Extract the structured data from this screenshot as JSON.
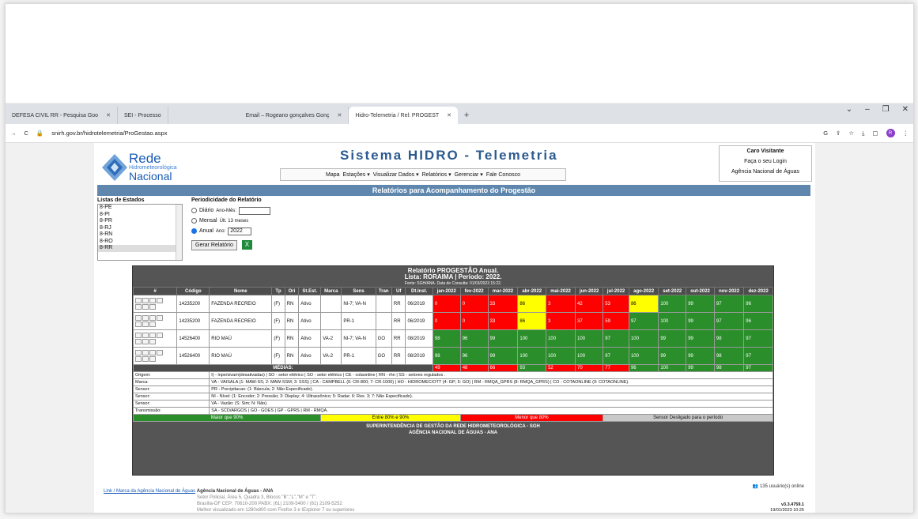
{
  "browser": {
    "tabs": [
      "DEFESA CIVIL RR - Pesquisa Goo",
      "SEI - Processo",
      "Email – Rogeano gonçalves Gonç",
      "Hidro-Telemetria / Rel: PROGEST"
    ],
    "url": "snirh.gov.br/hidrotelemetria/ProGestao.aspx"
  },
  "header": {
    "logo_l1": "Rede",
    "logo_l2": "Hidrometeorológica",
    "logo_l3": "Nacional",
    "title": "Sistema HIDRO - Telemetria",
    "menu": [
      "Mapa",
      "Estações ▾",
      "Visualizar Dados ▾",
      "Relatórios ▾",
      "Gerenciar ▾",
      "Fale Conosco"
    ],
    "visitor": {
      "title": "Caro Visitante",
      "login": "Faça o seu Login",
      "org": "Agência Nacional de Águas"
    }
  },
  "bar_title": "Relatórios para Acompanhamento do Progestão",
  "form": {
    "states_label": "Listas de Estados",
    "states": [
      "8-PE",
      "8-PI",
      "8-PR",
      "8-RJ",
      "8-RN",
      "8-RO",
      "8-RR"
    ],
    "period_label": "Periodicidade do Relatório",
    "daily": "Diário",
    "daily_hint": "Ano-Mês:",
    "monthly": "Mensal",
    "monthly_hint": "Últ. 13 meses",
    "annual": "Anual",
    "annual_hint": "Ano:",
    "year": "2022",
    "button": "Gerar Relatório"
  },
  "report": {
    "title": "Relatório PROGESTÃO Anual.",
    "subtitle": "Lista: RORAIMA | Período: 2022.",
    "source": "Fonte: SGH/ANA. Data de Consulta: 01/03/2023 15:22.",
    "columns": [
      "#",
      "Código",
      "Nome",
      "Tp",
      "Ori",
      "St.Est.",
      "Marca",
      "Sens",
      "Tran",
      "Uf",
      "Dt.Inst.",
      "jan-2022",
      "fev-2022",
      "mar-2022",
      "abr-2022",
      "mai-2022",
      "jun-2022",
      "jul-2022",
      "ago-2022",
      "set-2022",
      "out-2022",
      "nov-2022",
      "dez-2022"
    ],
    "rows": [
      {
        "code": "14235200",
        "name": "FAZENDA RECREIO",
        "tp": "(F)",
        "ori": "RN",
        "st": "Ativo",
        "marca": "",
        "sens": "NI-7; VA-N",
        "tran": "",
        "uf": "RR",
        "dt": "06/2019",
        "m": [
          "0",
          "0",
          "33",
          "86",
          "3",
          "42",
          "53",
          "86",
          "100",
          "99",
          "97",
          "96"
        ],
        "c": [
          "r",
          "r",
          "r",
          "y",
          "r",
          "r",
          "r",
          "y",
          "g",
          "g",
          "g",
          "g"
        ]
      },
      {
        "code": "14235200",
        "name": "FAZENDA RECREIO",
        "tp": "(F)",
        "ori": "RN",
        "st": "Ativo",
        "marca": "",
        "sens": "PR-1",
        "tran": "",
        "uf": "RR",
        "dt": "06/2019",
        "m": [
          "0",
          "0",
          "33",
          "86",
          "3",
          "37",
          "59",
          "97",
          "100",
          "99",
          "97",
          "96"
        ],
        "c": [
          "r",
          "r",
          "r",
          "y",
          "r",
          "r",
          "r",
          "g",
          "g",
          "g",
          "g",
          "g"
        ]
      },
      {
        "code": "14526400",
        "name": "RIO MAÚ",
        "tp": "(F)",
        "ori": "RN",
        "st": "Ativo",
        "marca": "VA-2",
        "sens": "NI-7; VA-N",
        "tran": "GO",
        "uf": "RR",
        "dt": "08/2019",
        "m": [
          "98",
          "96",
          "99",
          "100",
          "100",
          "100",
          "97",
          "100",
          "99",
          "99",
          "98",
          "97"
        ],
        "c": [
          "g",
          "g",
          "g",
          "g",
          "g",
          "g",
          "g",
          "g",
          "g",
          "g",
          "g",
          "g"
        ]
      },
      {
        "code": "14526400",
        "name": "RIO MAÚ",
        "tp": "(F)",
        "ori": "RN",
        "st": "Ativo",
        "marca": "VA-2",
        "sens": "PR-1",
        "tran": "GO",
        "uf": "RR",
        "dt": "08/2019",
        "m": [
          "98",
          "96",
          "99",
          "100",
          "100",
          "100",
          "97",
          "100",
          "99",
          "99",
          "98",
          "97"
        ],
        "c": [
          "g",
          "g",
          "g",
          "g",
          "g",
          "g",
          "g",
          "g",
          "g",
          "g",
          "g",
          "g"
        ]
      }
    ],
    "averages_label": "MÉDIAS:",
    "averages": [
      "49",
      "48",
      "66",
      "93",
      "52",
      "70",
      "77",
      "96",
      "100",
      "99",
      "98",
      "97"
    ],
    "averages_c": [
      "r",
      "r",
      "r",
      "g",
      "r",
      "r",
      "r",
      "g",
      "g",
      "g",
      "g",
      "g"
    ],
    "legend": [
      {
        "k": "Origem:",
        "v": "I) - inpe/sivam(desativadas) | SO - setor elétrico | SO - setor elétrico | CE - cotaonline | RN - rhn | SS - setores regulados ."
      },
      {
        "k": "Marca:",
        "v": "VA - VAISALA (1: MAW-SS; 2: MAW-SSM; 3: SSS) | CA - CAMPBELL (6: CR-800; 7: CR-1000) | HO - HIDROMEC/OTT (4: GP; 5: GO) | RM - RMQA_GPRS (8: RMQA_GPRS) | CO - COTAONLINE (9: COTAONLINE)."
      },
      {
        "k": "Sensor:",
        "v": "PR - Precipitacao: (1: Báscula; 2: Não Especificado)."
      },
      {
        "k": "Sensor:",
        "v": "NI - Nível: (1: Encoder; 2: Pressão; 3: Display; 4: Ultrassônico; 5: Radar; 6: Res. 3; 7: Não Especificado)."
      },
      {
        "k": "Sensor:",
        "v": "VA - Vazão: (S: Sim; N: Não)."
      },
      {
        "k": "Transmissão:",
        "v": "SA - SCD/ARGOS | GO - GOES | GP - GPRS | RM - RMQA."
      }
    ],
    "scale": [
      "Maior que 90%",
      "Entre 80% e 90%",
      "Menor que 80%",
      "Sensor Desligado para o período"
    ],
    "footer1": "SUPERINTENDÊNCIA DE GESTÃO DA REDE HIDROMETEOROLÓGICA - SGH",
    "footer2": "AGÊNCIA NACIONAL DE ÁGUAS - ANA"
  },
  "bottom": {
    "online": "135 usuário(s) online",
    "ana_link": "Link / Marca da Agência Nacional de Águas",
    "ana_name": "Agência Nacional de Águas - ANA",
    "addr1": "Setor Policial, Área 5, Quadra 3, Blocos \"B\",\"L\",\"M\" e \"T\".",
    "addr2": "Brasília-DF CEP: 70610-200  PABX: (61) 2109-5400 / (61) 2109-5252",
    "addr3": "Melhor visualizado em 1280x800 com Firefox 3 e IExplorer 7 ou superiores",
    "version": "v3.3.4759.1",
    "vdate": "19/01/2023 10:25"
  }
}
